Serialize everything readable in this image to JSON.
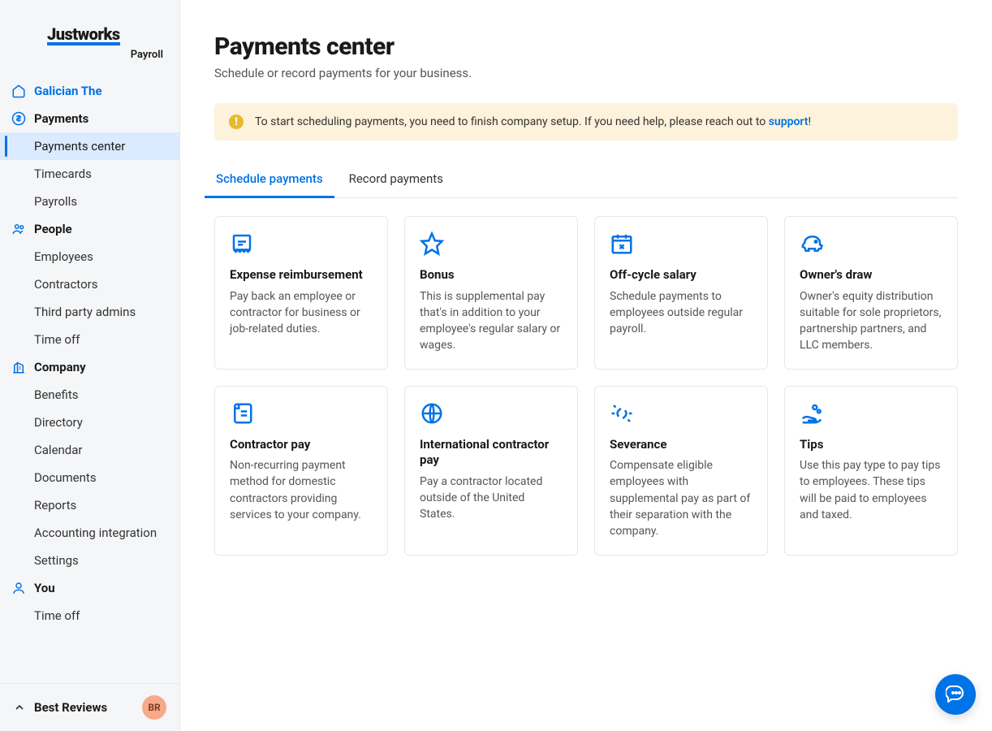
{
  "brand": {
    "name": "Justworks",
    "sub": "Payroll"
  },
  "company": {
    "name": "Galician The"
  },
  "nav": {
    "payments": {
      "label": "Payments",
      "items": [
        "Payments center",
        "Timecards",
        "Payrolls"
      ]
    },
    "people": {
      "label": "People",
      "items": [
        "Employees",
        "Contractors",
        "Third party admins",
        "Time off"
      ]
    },
    "companySection": {
      "label": "Company",
      "items": [
        "Benefits",
        "Directory",
        "Calendar",
        "Documents",
        "Reports",
        "Accounting integration",
        "Settings"
      ]
    },
    "you": {
      "label": "You",
      "items": [
        "Time off"
      ]
    }
  },
  "footer": {
    "label": "Best Reviews",
    "avatar": "BR"
  },
  "page": {
    "title": "Payments center",
    "subtitle": "Schedule or record payments for your business."
  },
  "alert": {
    "pre": "To start scheduling payments, you need to finish company setup. If you need help, please reach out to ",
    "link": "support",
    "post": "!"
  },
  "tabs": [
    "Schedule payments",
    "Record payments"
  ],
  "cards": [
    {
      "title": "Expense reimbursement",
      "desc": "Pay back an employee or contractor for business or job-related duties.",
      "icon": "receipt"
    },
    {
      "title": "Bonus",
      "desc": "This is supplemental pay that's in addition to your employee's regular salary or wages.",
      "icon": "star"
    },
    {
      "title": "Off-cycle salary",
      "desc": "Schedule payments to employees outside regular payroll.",
      "icon": "calendar-x"
    },
    {
      "title": "Owner's draw",
      "desc": "Owner's equity distribution suitable for sole proprietors, partnership partners, and LLC members.",
      "icon": "piggy"
    },
    {
      "title": "Contractor pay",
      "desc": "Non-recurring payment method for domestic contractors providing services to your company.",
      "icon": "scroll"
    },
    {
      "title": "International contractor pay",
      "desc": "Pay a contractor located outside of the United States.",
      "icon": "globe"
    },
    {
      "title": "Severance",
      "desc": "Compensate eligible employees with supplemental pay as part of their separation with the company.",
      "icon": "broken-link"
    },
    {
      "title": "Tips",
      "desc": "Use this pay type to pay tips to employees. These tips will be paid to employees and taxed.",
      "icon": "hand-coins"
    }
  ]
}
